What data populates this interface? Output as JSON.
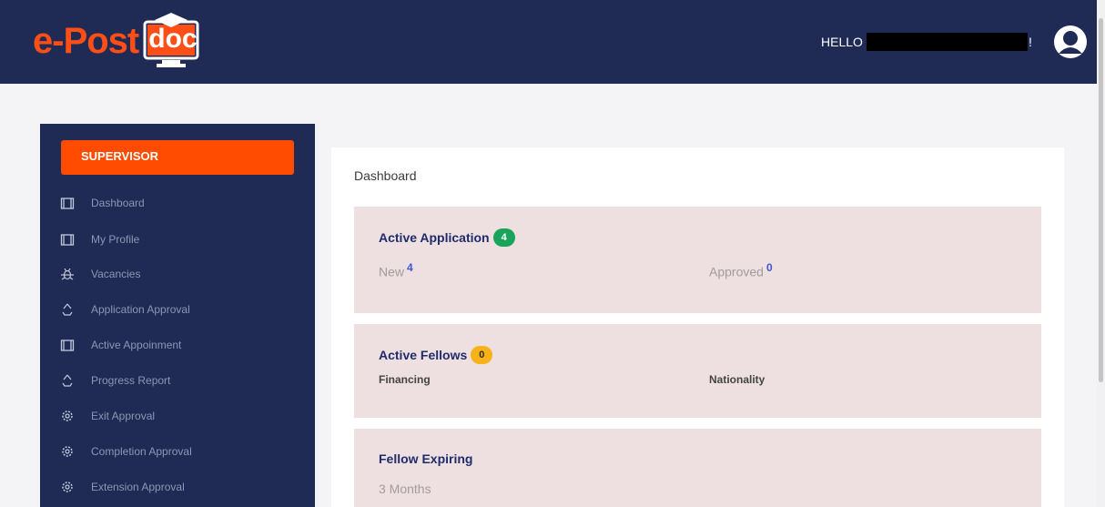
{
  "header": {
    "logo_text": "e-Post",
    "logo_mark_text": "doc",
    "greeting": "HELLO",
    "greeting_suffix": "!"
  },
  "sidebar": {
    "role_label": "SUPERVISOR",
    "items": [
      {
        "label": "Dashboard",
        "icon": "briefcase-icon"
      },
      {
        "label": "My Profile",
        "icon": "briefcase-icon"
      },
      {
        "label": "Vacancies",
        "icon": "bug-icon"
      },
      {
        "label": "Application Approval",
        "icon": "recycle-icon"
      },
      {
        "label": "Active Appoinment",
        "icon": "briefcase-icon"
      },
      {
        "label": "Progress Report",
        "icon": "recycle-icon"
      },
      {
        "label": "Exit Approval",
        "icon": "cog-icon"
      },
      {
        "label": "Completion Approval",
        "icon": "cog-icon"
      },
      {
        "label": "Extension Approval",
        "icon": "cog-icon"
      }
    ]
  },
  "main": {
    "title": "Dashboard",
    "cards": {
      "active_application": {
        "title": "Active Application",
        "badge": "4",
        "new_label": "New",
        "new_value": "4",
        "approved_label": "Approved",
        "approved_value": "0"
      },
      "active_fellows": {
        "title": "Active Fellows",
        "badge": "0",
        "financing_label": "Financing",
        "nationality_label": "Nationality"
      },
      "fellow_expiring": {
        "title": "Fellow Expiring",
        "period_label": "3 Months"
      }
    }
  },
  "colors": {
    "navy": "#1f2b55",
    "accent_orange": "#ff4c00",
    "badge_green": "#1aa35a",
    "badge_yellow": "#f7b21a",
    "card_bg": "#eee0e0"
  }
}
